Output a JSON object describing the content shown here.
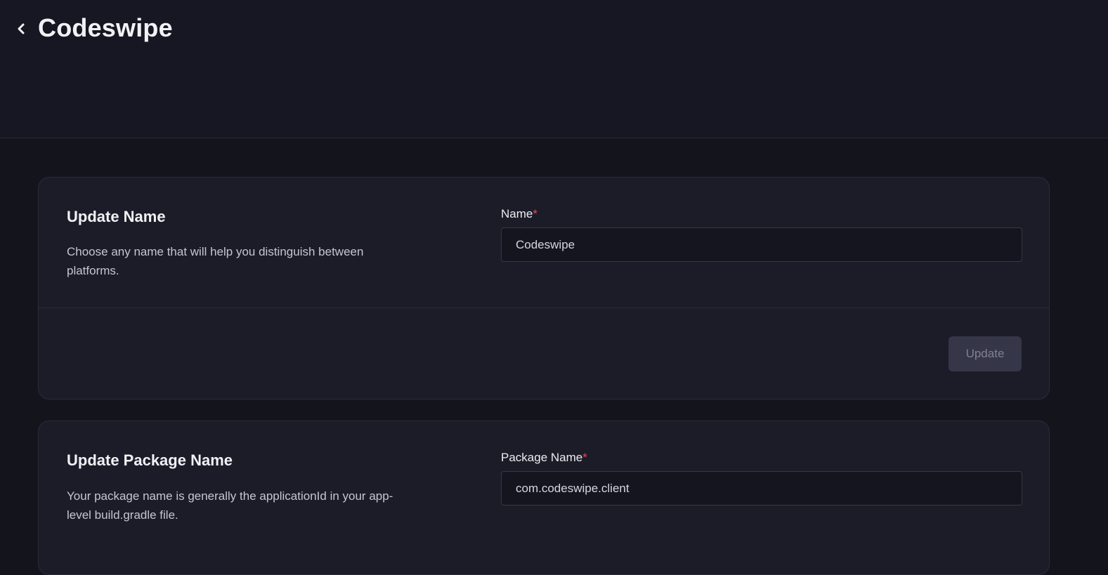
{
  "header": {
    "back_icon": "chevron-left-icon",
    "title": "Codeswipe"
  },
  "name_card": {
    "title": "Update Name",
    "description": "Choose any name that will help you distinguish between platforms.",
    "field_label": "Name",
    "required_mark": "*",
    "value": "Codeswipe",
    "button_label": "Update",
    "button_state": "disabled"
  },
  "package_card": {
    "title": "Update Package Name",
    "description": "Your package name is generally the applicationId in your app-level build.gradle file.",
    "field_label": "Package Name",
    "required_mark": "*",
    "value": "com.codeswipe.client"
  },
  "colors": {
    "page_bg": "#14141d",
    "header_bg": "#171723",
    "card_bg": "#1c1c28",
    "required": "#f0444e",
    "button_disabled_bg": "#353648"
  }
}
